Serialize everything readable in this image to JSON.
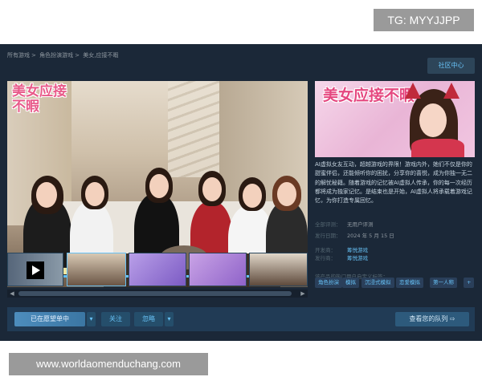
{
  "watermark_top": "TG: MYYJJPP",
  "watermark_bottom": "www.worldaomenduchang.com",
  "breadcrumb": [
    "所有游戏",
    "角色扮演游戏",
    "美女,应接不暇"
  ],
  "community_hub": "社区中心",
  "game_title_art": "美女应接不暇",
  "description": "AI虚拟女友互动，超越游戏的界限！游戏内外，她们不仅是你的甜蜜伴侣，还能倾听你的困扰，分享你的喜悦，成为你独一无二的解忧秘籍。随着游戏的记忆被AI虚拟人传承，你的每一次经历都将成为独家记忆。是结束也是开始，AI虚拟人将承载着游戏记忆，为你打造专属回忆。",
  "meta": {
    "reviews_label": "全部评测：",
    "reviews_value": "无用户评测",
    "release_label": "发行日期：",
    "release_value": "2024 年 5 月 15 日",
    "developer_label": "开发商：",
    "developer_value": "筹悦游戏",
    "publisher_label": "发行商：",
    "publisher_value": "筹悦游戏"
  },
  "tags_label": "该产品的热门用户自定义标签：",
  "tags": [
    "角色扮演",
    "模拟",
    "沉浸式模拟",
    "恋爱模拟",
    "第一人称",
    "+"
  ],
  "actions": {
    "wishlist": "已在愿望单中",
    "follow": "关注",
    "ignore": "忽略",
    "queue": "查看您的队列"
  },
  "progress": 0.94,
  "colors": {
    "steam_bg": "#1b2838",
    "accent": "#66c0f4",
    "link": "#67c1f5"
  }
}
